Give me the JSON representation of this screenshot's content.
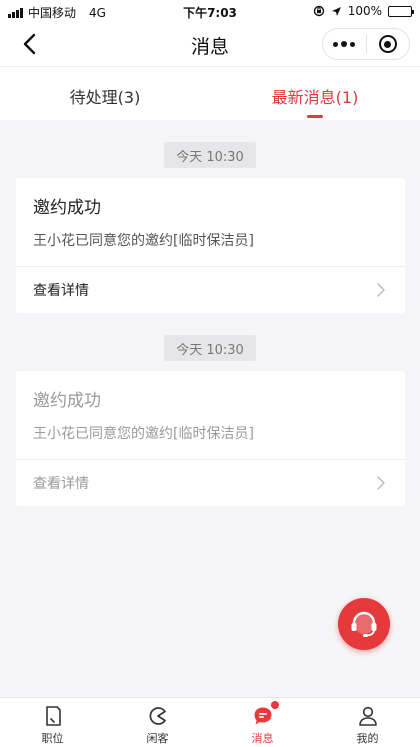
{
  "status_bar": {
    "carrier": "中国移动",
    "network": "4G",
    "time": "下午7:03",
    "battery": "100%",
    "battery_level": 1.0
  },
  "nav": {
    "title": "消息",
    "back_icon": "chevron-left-icon",
    "more_icon": "more-dots-icon",
    "close_icon": "target-close-icon"
  },
  "tabs": [
    {
      "label": "待处理(3)",
      "active": false
    },
    {
      "label": "最新消息(1)",
      "active": true
    }
  ],
  "messages": [
    {
      "time": "今天  10:30",
      "title": "邀约成功",
      "text": "王小花已同意您的邀约[临时保洁员]",
      "link_label": "查看详情",
      "read": false
    },
    {
      "time": "今天  10:30",
      "title": "邀约成功",
      "text": "王小花已同意您的邀约[临时保洁员]",
      "link_label": "查看详情",
      "read": true
    }
  ],
  "support_icon": "headset-icon",
  "colors": {
    "accent": "#e5393c",
    "background": "#f5f5f7",
    "card": "#ffffff",
    "muted_text": "#9a9a9a"
  },
  "tabbar": [
    {
      "label": "职位",
      "icon": "resume-icon",
      "active": false
    },
    {
      "label": "闲客",
      "icon": "pacman-icon",
      "active": false
    },
    {
      "label": "消息",
      "icon": "chat-bubble-icon",
      "active": true,
      "badge": true
    },
    {
      "label": "我的",
      "icon": "user-icon",
      "active": false
    }
  ]
}
